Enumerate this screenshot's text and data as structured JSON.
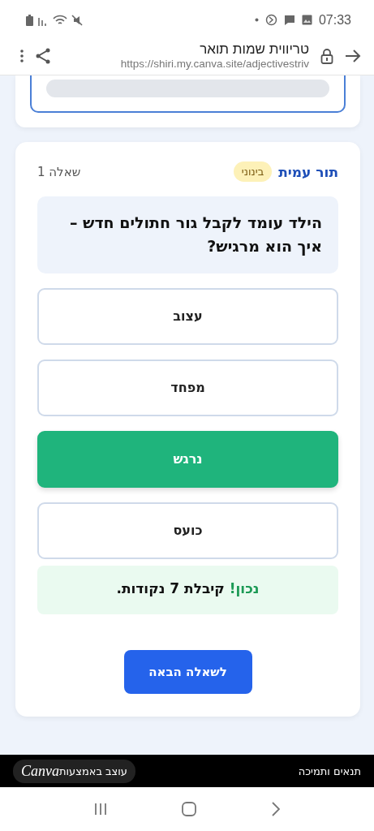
{
  "status_bar": {
    "time": "07:33"
  },
  "browser": {
    "title": "טריווית שמות תואר",
    "url": "https://shiri.my.canva.site/adjectivestriv"
  },
  "question_card": {
    "player": "תור עמית",
    "level": "בינוני",
    "counter": "שאלה 1",
    "question": "הילד עומד לקבל גור חתולים חדש – איך הוא מרגיש?",
    "options": [
      {
        "label": "עצוב",
        "selected": false
      },
      {
        "label": "מפחד",
        "selected": false
      },
      {
        "label": "נרגש",
        "selected": true
      },
      {
        "label": "כועס",
        "selected": false
      }
    ],
    "feedback": {
      "verdict": "נכון!",
      "text": "קיבלת 7 נקודות."
    },
    "next_button": "לשאלה הבאה"
  },
  "footer": {
    "terms": "תנאים ותמיכה",
    "made_with": "עוצב באמצעות",
    "brand": "Canva"
  }
}
